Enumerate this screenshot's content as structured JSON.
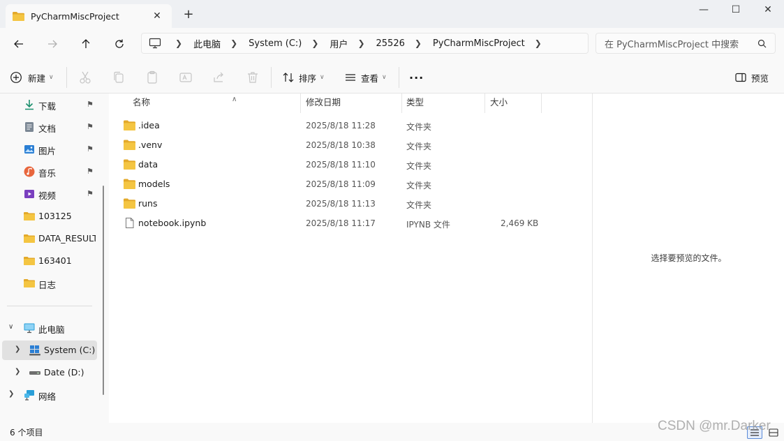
{
  "window": {
    "tab_title": "PyCharmMiscProject",
    "tab_close": "✕",
    "new_tab": "+",
    "minimize": "—",
    "maximize": "☐",
    "close": "✕"
  },
  "address": {
    "crumbs": [
      "此电脑",
      "System (C:)",
      "用户",
      "25526",
      "PyCharmMiscProject"
    ],
    "search_placeholder": "在 PyCharmMiscProject 中搜索"
  },
  "toolbar": {
    "new_label": "新建",
    "sort_label": "排序",
    "view_label": "查看",
    "more_label": "···",
    "preview_label": "预览"
  },
  "sidebar": {
    "quick": [
      {
        "label": "下载",
        "icon": "download-icon",
        "pinned": true
      },
      {
        "label": "文档",
        "icon": "document-icon",
        "pinned": true
      },
      {
        "label": "图片",
        "icon": "pictures-icon",
        "pinned": true
      },
      {
        "label": "音乐",
        "icon": "music-icon",
        "pinned": true
      },
      {
        "label": "视频",
        "icon": "video-icon",
        "pinned": true
      },
      {
        "label": "103125",
        "icon": "folder-icon",
        "pinned": false
      },
      {
        "label": "DATA_RESULT",
        "icon": "folder-icon",
        "pinned": false
      },
      {
        "label": "163401",
        "icon": "folder-icon",
        "pinned": false
      },
      {
        "label": "日志",
        "icon": "folder-icon",
        "pinned": false
      }
    ],
    "this_pc": "此电脑",
    "drive_c": "System (C:)",
    "drive_d": "Date (D:)",
    "network": "网络"
  },
  "columns": {
    "name": "名称",
    "modified": "修改日期",
    "type": "类型",
    "size": "大小"
  },
  "files": [
    {
      "name": ".idea",
      "modified": "2025/8/18 11:28",
      "type": "文件夹",
      "size": "",
      "kind": "folder"
    },
    {
      "name": ".venv",
      "modified": "2025/8/18 10:38",
      "type": "文件夹",
      "size": "",
      "kind": "folder"
    },
    {
      "name": "data",
      "modified": "2025/8/18 11:10",
      "type": "文件夹",
      "size": "",
      "kind": "folder"
    },
    {
      "name": "models",
      "modified": "2025/8/18 11:09",
      "type": "文件夹",
      "size": "",
      "kind": "folder"
    },
    {
      "name": "runs",
      "modified": "2025/8/18 11:13",
      "type": "文件夹",
      "size": "",
      "kind": "folder"
    },
    {
      "name": "notebook.ipynb",
      "modified": "2025/8/18 11:17",
      "type": "IPYNB 文件",
      "size": "2,469 KB",
      "kind": "file"
    }
  ],
  "preview": {
    "message": "选择要预览的文件。"
  },
  "status": {
    "count": "6 个项目"
  },
  "watermark": "CSDN @mr.Darker",
  "colors": {
    "folder": "#f4c542",
    "folder_dark": "#e3a92a",
    "accent": "#0067c0"
  }
}
